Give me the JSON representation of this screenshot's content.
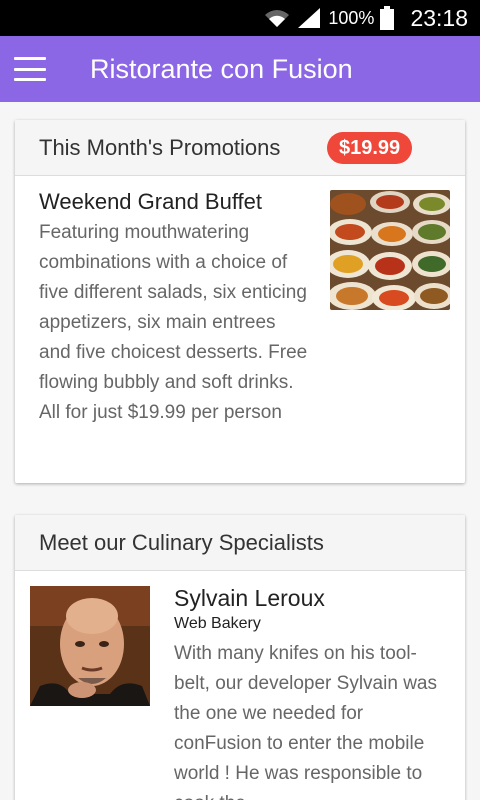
{
  "status_bar": {
    "battery": "100%",
    "time": "23:18",
    "icons": [
      "wifi-icon",
      "signal-icon",
      "battery-icon"
    ]
  },
  "app_bar": {
    "title": "Ristorante con Fusion",
    "menu_icon": "hamburger-menu-icon",
    "color": "#8b67e6"
  },
  "promotions": {
    "header": "This Month's Promotions",
    "price_badge": "$19.99",
    "badge_color": "#ef473a",
    "item": {
      "title": "Weekend Grand Buffet",
      "description": "Featuring mouthwatering combinations with a choice of five different salads, six enticing appetizers, six main entrees and five choicest desserts. Free flowing bubbly and soft drinks. All for just $19.99 per person",
      "image": "buffet-dishes-thumbnail"
    }
  },
  "specialists": {
    "header": "Meet our Culinary Specialists",
    "person": {
      "name": "Sylvain Leroux",
      "role": "Web Bakery",
      "description": "With many knifes on his tool-belt, our developer Sylvain was the one we needed for conFusion to enter the mobile world ! He was responsible to cook the",
      "image": "chef-portrait"
    }
  }
}
